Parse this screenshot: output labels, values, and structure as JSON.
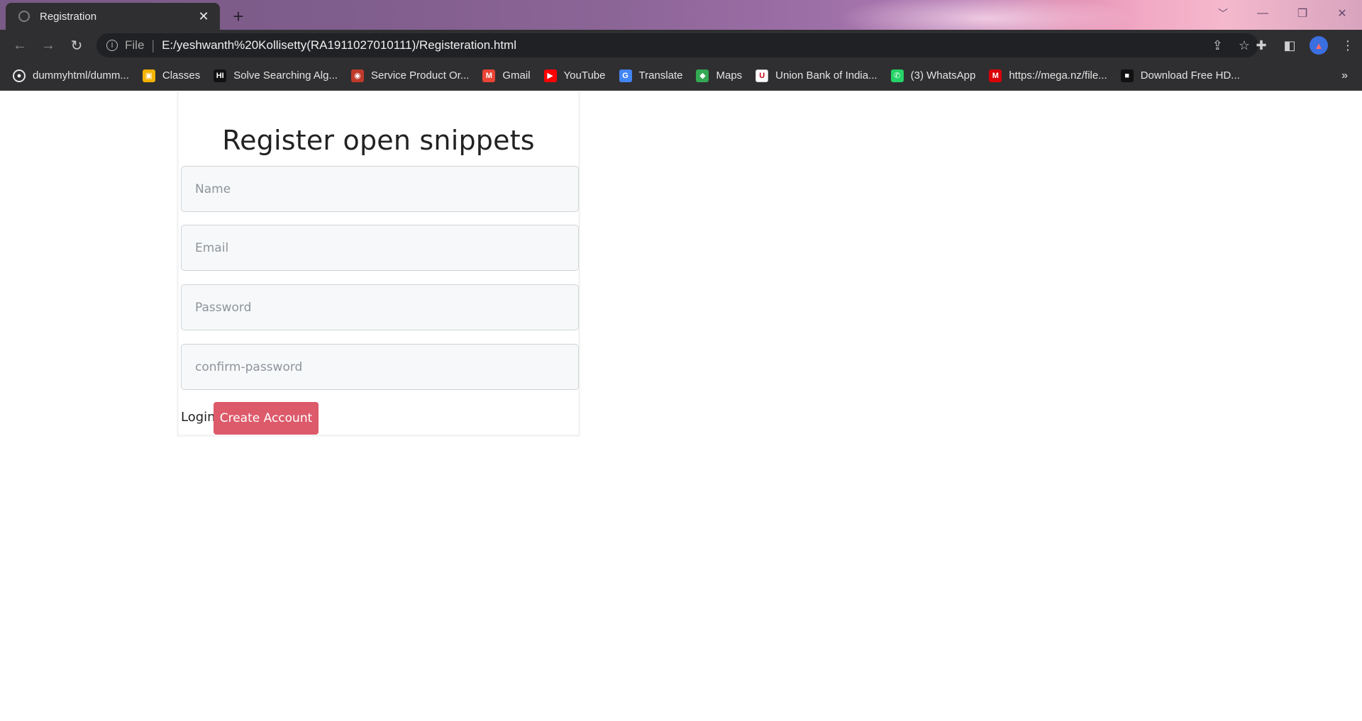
{
  "browser": {
    "tab_title": "Registration",
    "new_tab_label": "+",
    "omnibox": {
      "scheme_label": "File",
      "separator": "|",
      "url": "E:/yeshwanth%20Kollisetty(RA1911027010111)/Registeration.html"
    },
    "bookmarks": [
      {
        "label": "dummyhtml/dumm...",
        "icon": "github-icon",
        "color": "#2f2f31"
      },
      {
        "label": "Classes",
        "icon": "classroom-icon",
        "color": "#f2b300"
      },
      {
        "label": "Solve Searching Alg...",
        "icon": "hackerrank-icon",
        "color": "#111111"
      },
      {
        "label": "Service Product Or...",
        "icon": "service-icon",
        "color": "#c0392b"
      },
      {
        "label": "Gmail",
        "icon": "gmail-icon",
        "color": "#ea4335"
      },
      {
        "label": "YouTube",
        "icon": "youtube-icon",
        "color": "#ff0000"
      },
      {
        "label": "Translate",
        "icon": "translate-icon",
        "color": "#4285f4"
      },
      {
        "label": "Maps",
        "icon": "maps-icon",
        "color": "#34a853"
      },
      {
        "label": "Union Bank of India...",
        "icon": "unionbank-icon",
        "color": "#ffffff"
      },
      {
        "label": "(3) WhatsApp",
        "icon": "whatsapp-icon",
        "color": "#25d366"
      },
      {
        "label": "https://mega.nz/file...",
        "icon": "mega-icon",
        "color": "#d90007"
      },
      {
        "label": "Download Free HD...",
        "icon": "download-icon",
        "color": "#111111"
      }
    ],
    "bookmarks_overflow": "»"
  },
  "form": {
    "title": "Register open snippets",
    "name_placeholder": "Name",
    "email_placeholder": "Email",
    "password_placeholder": "Password",
    "confirm_placeholder": "confirm-password",
    "login_label": "Login",
    "submit_label": "Create Account"
  },
  "colors": {
    "submit_button": "#dd5a6a",
    "chrome_dark": "#2f2f31"
  }
}
